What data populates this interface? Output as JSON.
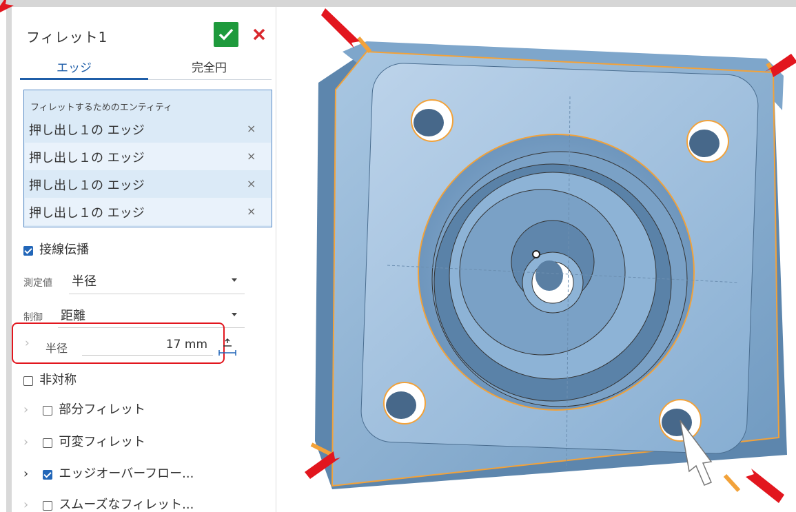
{
  "feature": {
    "title": "フィレット1",
    "ok_icon": "check-icon",
    "cancel_icon": "close-icon"
  },
  "tabs": [
    {
      "label": "エッジ",
      "active": true
    },
    {
      "label": "完全円",
      "active": false
    }
  ],
  "entities": {
    "header": "フィレットするためのエンティティ",
    "items": [
      {
        "label": "押し出し１の エッジ",
        "remove": "×"
      },
      {
        "label": "押し出し１の エッジ",
        "remove": "×"
      },
      {
        "label": "押し出し１の エッジ",
        "remove": "×"
      },
      {
        "label": "押し出し１の エッジ",
        "remove": "×"
      }
    ]
  },
  "options": {
    "tangent": {
      "label": "接線伝播",
      "checked": true
    },
    "measure": {
      "label": "測定値",
      "value": "半径"
    },
    "control": {
      "label": "制御",
      "value": "距離"
    },
    "radius": {
      "label": "半径",
      "value": "17 mm"
    },
    "asymmetric": {
      "label": "非対称",
      "checked": false
    },
    "partial": {
      "label": "部分フィレット",
      "checked": false
    },
    "variable": {
      "label": "可変フィレット",
      "checked": false
    },
    "overflow": {
      "label": "エッジオーバーフロー...",
      "checked": true
    },
    "smooth": {
      "label": "スムーズなフィレット...",
      "checked": false
    }
  },
  "colors": {
    "accent": "#1f5ea8",
    "ok": "#1e9a3c",
    "cancel": "#d9262c",
    "highlight_box": "#e2161e",
    "model_blue": "#8fb7d8",
    "edge_orange": "#f2a23a"
  }
}
